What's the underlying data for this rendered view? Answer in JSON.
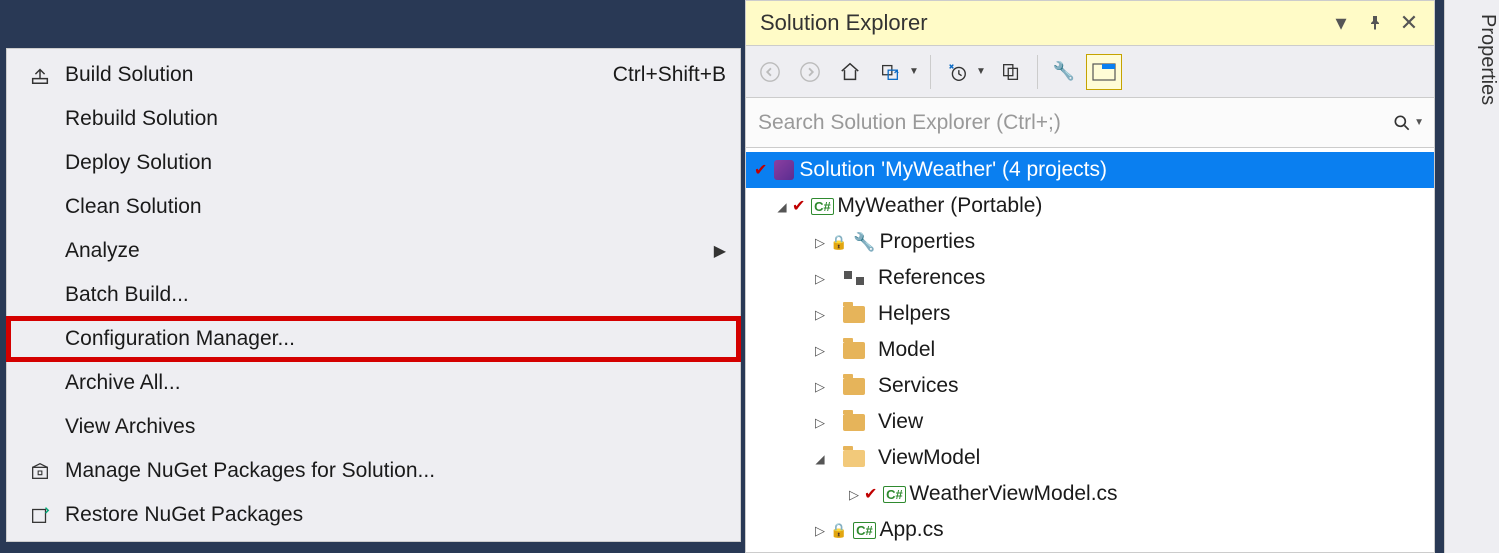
{
  "context_menu": {
    "items": [
      {
        "label": "Build Solution",
        "shortcut": "Ctrl+Shift+B",
        "icon": "build",
        "submenu": false
      },
      {
        "label": "Rebuild Solution",
        "shortcut": "",
        "icon": "",
        "submenu": false
      },
      {
        "label": "Deploy Solution",
        "shortcut": "",
        "icon": "",
        "submenu": false
      },
      {
        "label": "Clean Solution",
        "shortcut": "",
        "icon": "",
        "submenu": false
      },
      {
        "label": "Analyze",
        "shortcut": "",
        "icon": "",
        "submenu": true
      },
      {
        "label": "Batch Build...",
        "shortcut": "",
        "icon": "",
        "submenu": false
      },
      {
        "label": "Configuration Manager...",
        "shortcut": "",
        "icon": "",
        "submenu": false,
        "highlighted": true
      },
      {
        "label": "Archive All...",
        "shortcut": "",
        "icon": "",
        "submenu": false
      },
      {
        "label": "View Archives",
        "shortcut": "",
        "icon": "",
        "submenu": false
      },
      {
        "label": "Manage NuGet Packages for Solution...",
        "shortcut": "",
        "icon": "nuget",
        "submenu": false
      },
      {
        "label": "Restore NuGet Packages",
        "shortcut": "",
        "icon": "restore",
        "submenu": false
      }
    ]
  },
  "panel": {
    "title": "Solution Explorer",
    "search_placeholder": "Search Solution Explorer (Ctrl+;)"
  },
  "tree": {
    "solution": "Solution 'MyWeather' (4 projects)",
    "project": "MyWeather (Portable)",
    "nodes": [
      {
        "label": "Properties",
        "icon": "wrench"
      },
      {
        "label": "References",
        "icon": "ref"
      },
      {
        "label": "Helpers",
        "icon": "folder"
      },
      {
        "label": "Model",
        "icon": "folder"
      },
      {
        "label": "Services",
        "icon": "folder"
      },
      {
        "label": "View",
        "icon": "folder"
      }
    ],
    "viewmodel": "ViewModel",
    "viewmodel_file": "WeatherViewModel.cs",
    "app_file": "App.cs"
  },
  "side_tab": "Properties"
}
